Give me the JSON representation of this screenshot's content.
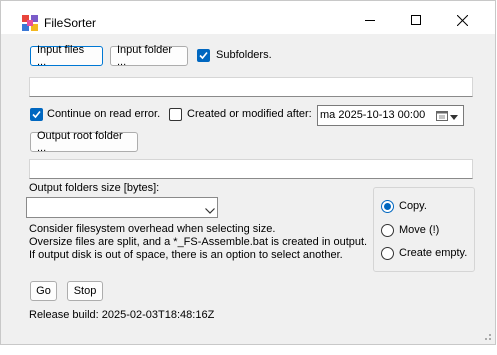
{
  "window": {
    "title": "FileSorter"
  },
  "toolbar": {
    "input_files_label": "Input files ...",
    "input_folder_label": "Input folder ...",
    "subfolders_label": "Subfolders."
  },
  "input_path": {
    "value": ""
  },
  "options": {
    "continue_on_error_label": "Continue on read error.",
    "created_modified_label": "Created or modified after:",
    "date_value": "ma 2025-10-13 00:00",
    "output_root_label": "Output root folder ..."
  },
  "output_path": {
    "value": ""
  },
  "size": {
    "label": "Output folders size [bytes]:",
    "selected": ""
  },
  "info": {
    "line1": "Consider filesystem overhead when selecting size.",
    "line2": "Oversize files are split, and a *_FS-Assemble.bat is created in output.",
    "line3": "If output disk is out of space, there is an option to select another."
  },
  "mode": {
    "copy_label": "Copy.",
    "move_label": "Move (!)",
    "create_empty_label": "Create empty.",
    "selected": "copy"
  },
  "actions": {
    "go_label": "Go",
    "stop_label": "Stop"
  },
  "footer": {
    "release_build": "Release build: 2025-02-03T18:48:16Z"
  },
  "colors": {
    "accent": "#0067c0",
    "window_bg": "#f0f0f0",
    "titlebar_bg": "#ffffff"
  }
}
